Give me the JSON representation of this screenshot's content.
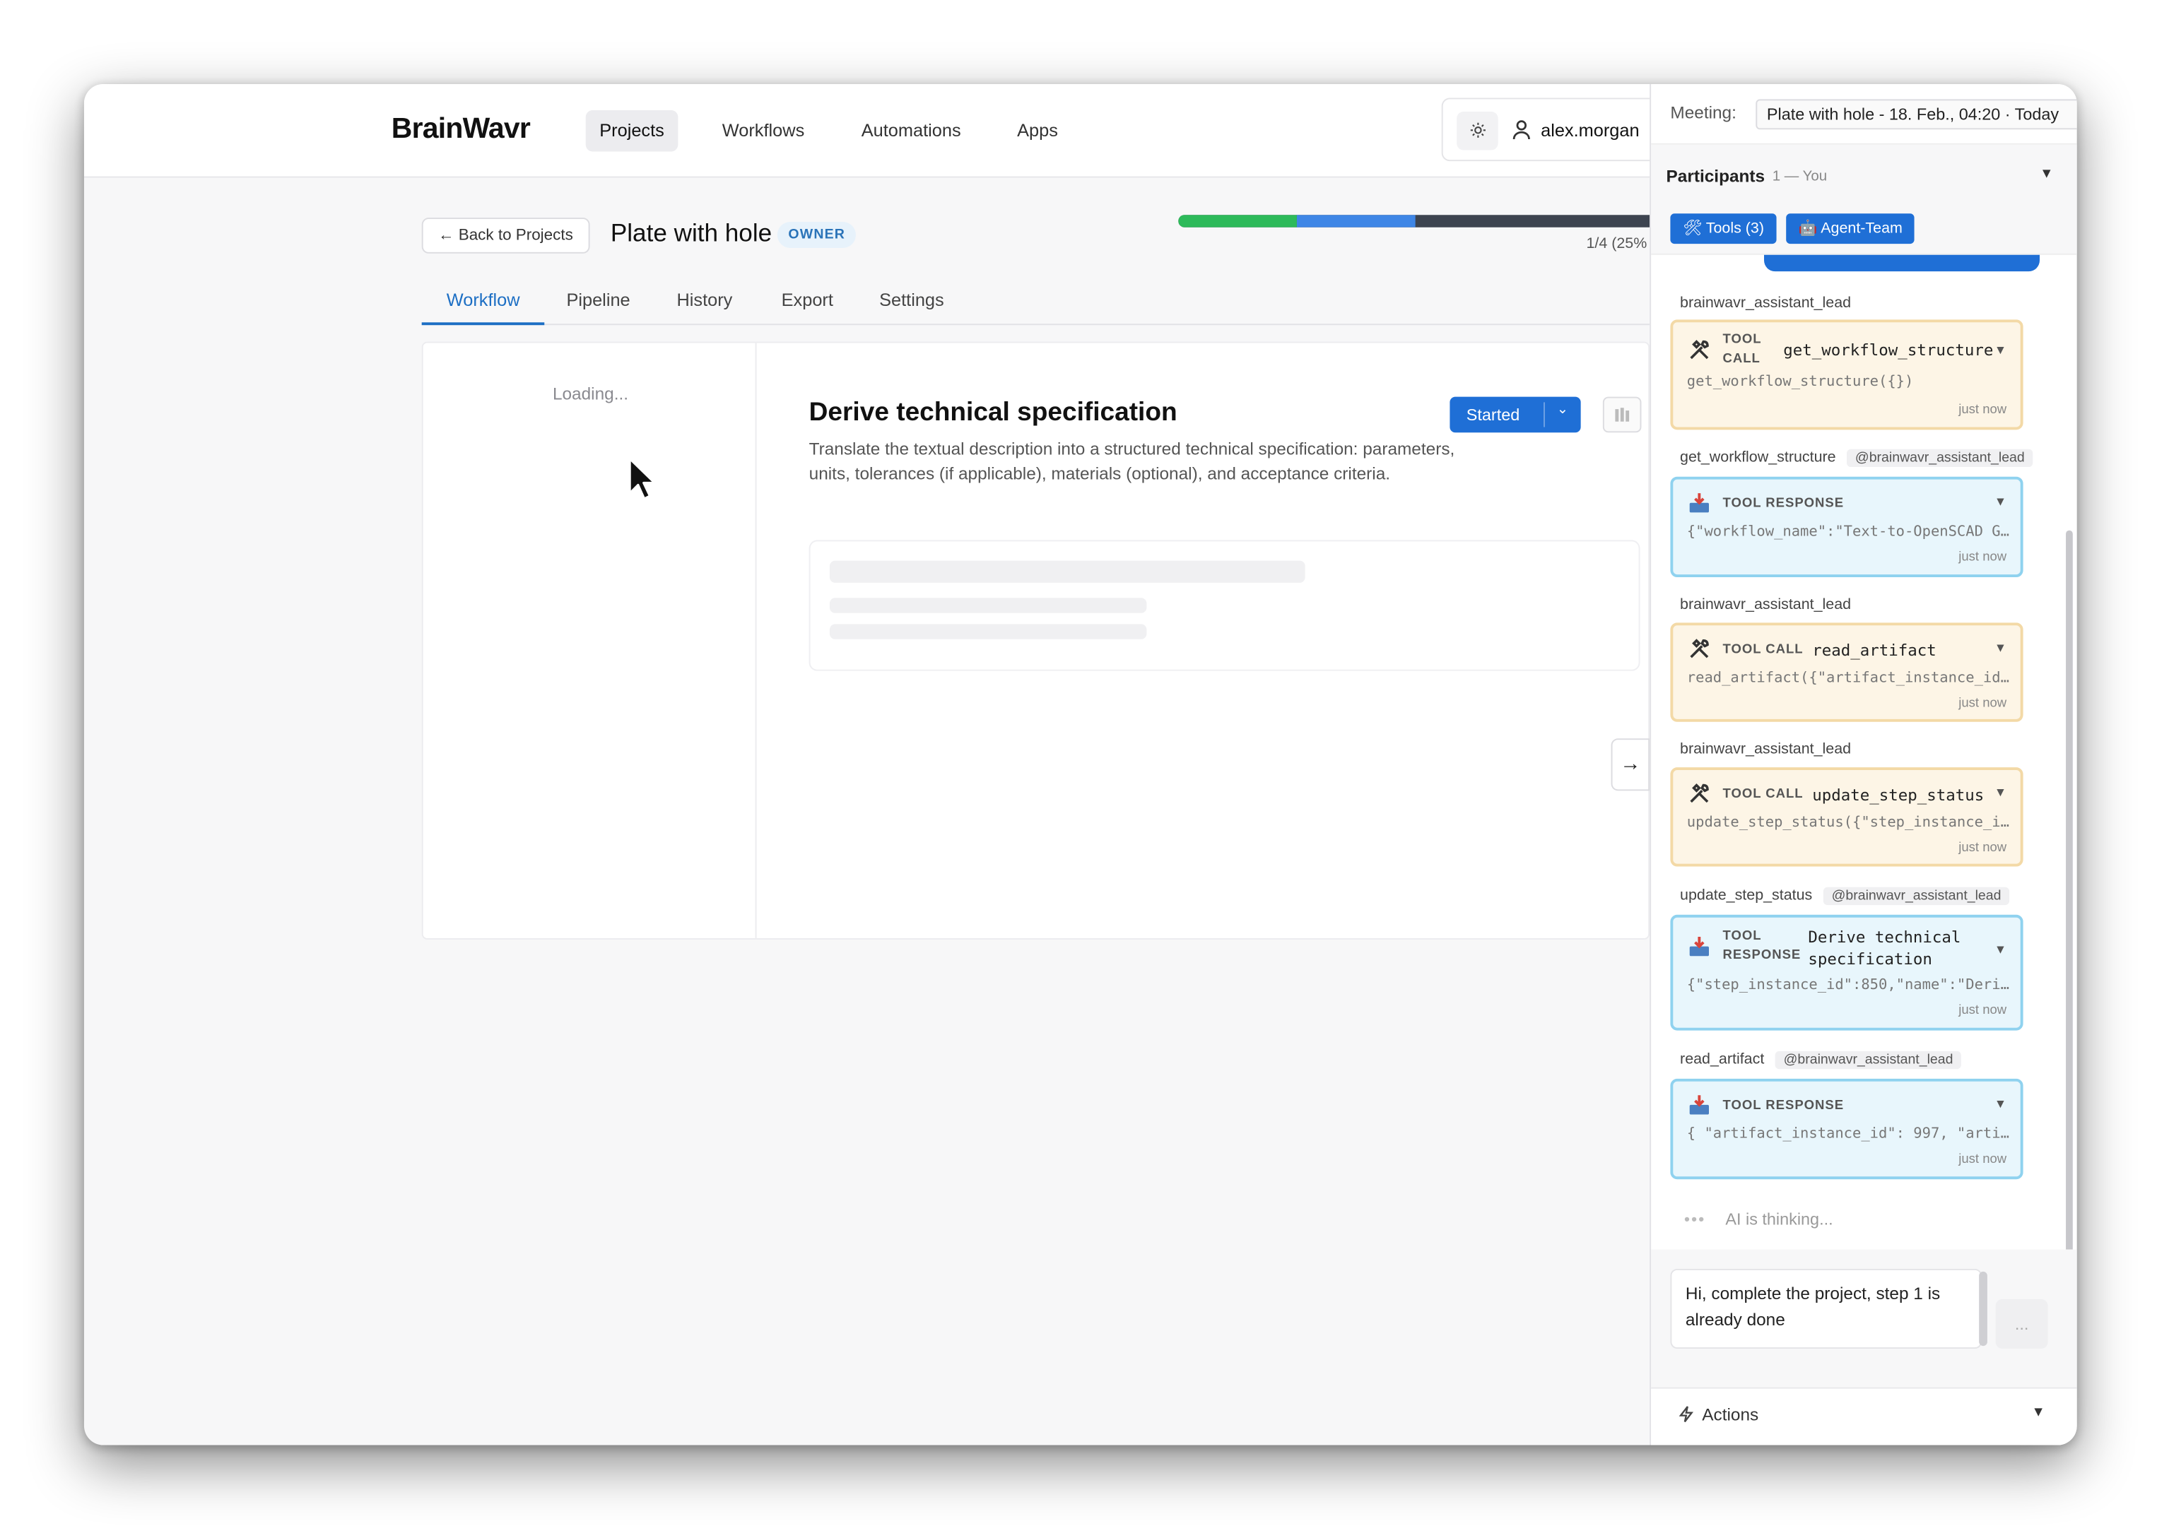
{
  "nav": {
    "logo": "BrainWavr",
    "items": [
      "Projects",
      "Workflows",
      "Automations",
      "Apps"
    ],
    "username": "alex.morgan"
  },
  "project": {
    "back_label": "← Back to Projects",
    "title": "Plate with hole",
    "role_badge": "OWNER",
    "progress_text": "1/4 (25%",
    "progress": {
      "fraction": 0.25,
      "segment_colors": [
        "#2dba5a",
        "#3f86e6",
        "#3d4450"
      ]
    }
  },
  "tabs": [
    "Workflow",
    "Pipeline",
    "History",
    "Export",
    "Settings"
  ],
  "workflow": {
    "loading": "Loading...",
    "step_title": "Derive technical specification",
    "step_description": "Translate the textual description into a structured technical specification: parameters, units, tolerances (if applicable), materials (optional), and acceptance criteria.",
    "status_label": "Started"
  },
  "chat": {
    "meeting_label": "Meeting:",
    "meeting_value": "Plate with hole - 18. Feb., 04:20 · Today",
    "participants_label": "Participants",
    "participants_count": "1 — You",
    "chips": [
      "🛠 Tools (3)",
      "🤖 Agent-Team"
    ],
    "messages": [
      {
        "author": "brainwavr_assistant_lead",
        "mention": "",
        "kind_line1": "TOOL",
        "kind_line2": "CALL",
        "fn": "get_workflow_structure",
        "args": "get_workflow_structure({})",
        "time": "just now"
      },
      {
        "author": "get_workflow_structure",
        "mention": "@brainwavr_assistant_lead",
        "kind_line1": "TOOL RESPONSE",
        "kind_line2": "",
        "fn": "",
        "args": "{\"workflow_name\":\"Text-to-OpenSCAD G...",
        "time": "just now"
      },
      {
        "author": "brainwavr_assistant_lead",
        "mention": "",
        "kind_line1": "TOOL CALL",
        "kind_line2": "",
        "fn": "read_artifact",
        "args": "read_artifact({\"artifact_instance_id...",
        "time": "just now"
      },
      {
        "author": "brainwavr_assistant_lead",
        "mention": "",
        "kind_line1": "TOOL CALL",
        "kind_line2": "",
        "fn": "update_step_status",
        "args": "update_step_status({\"step_instance_i...",
        "time": "just now"
      },
      {
        "author": "update_step_status",
        "mention": "@brainwavr_assistant_lead",
        "kind_line1": "TOOL",
        "kind_line2": "RESPONSE",
        "fn": "Derive technical specification",
        "args": "{\"step_instance_id\":850,\"name\":\"Deri...",
        "time": "just now"
      },
      {
        "author": "read_artifact",
        "mention": "@brainwavr_assistant_lead",
        "kind_line1": "TOOL RESPONSE",
        "kind_line2": "",
        "fn": "",
        "args": "{ \"artifact_instance_id\": 997, \"arti...",
        "time": "just now"
      }
    ],
    "thinking": "AI is thinking...",
    "composer_text": "Hi, complete the project, step 1 is already done",
    "send_label": "...",
    "actions_label": "Actions"
  }
}
